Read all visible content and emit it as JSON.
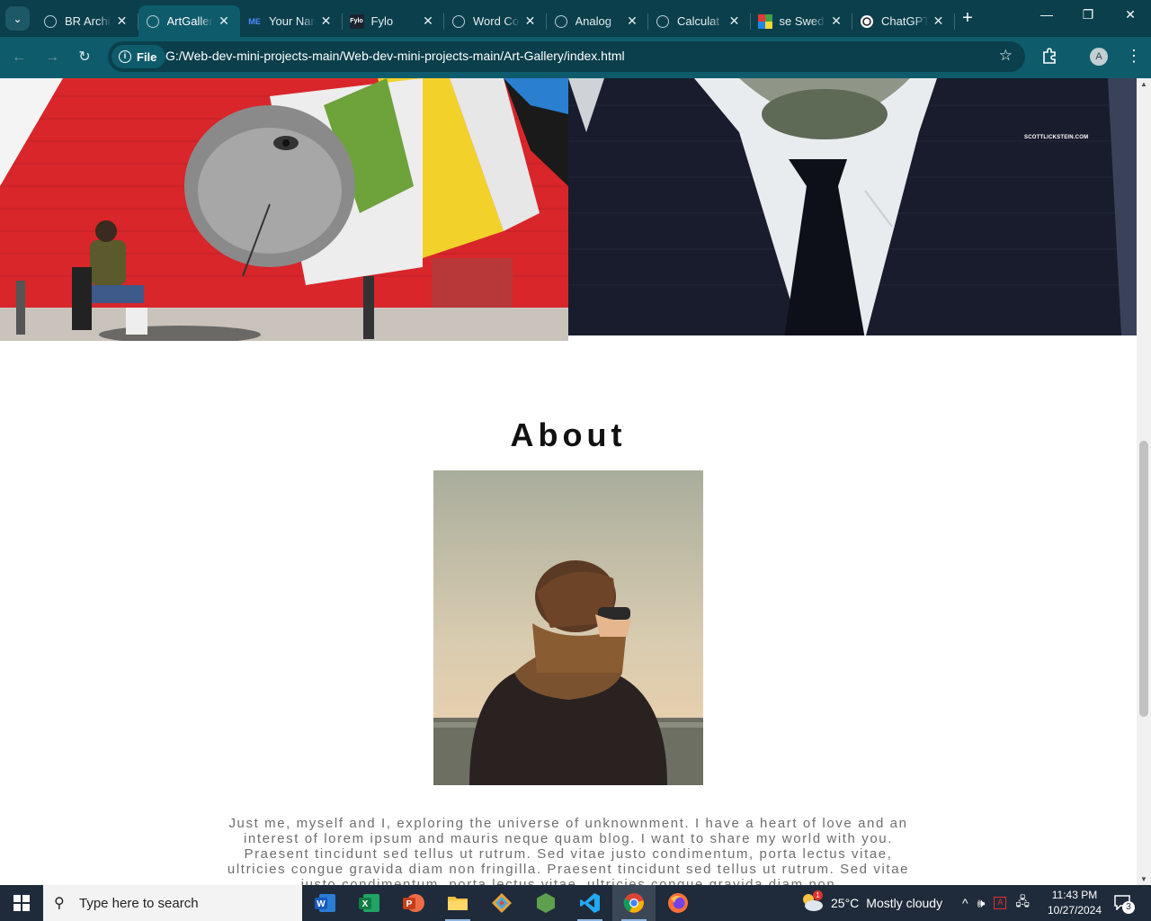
{
  "browser": {
    "tabs": [
      {
        "title": "BR Archi",
        "icon": "globe-icon"
      },
      {
        "title": "ArtGallery",
        "icon": "globe-icon",
        "active": true
      },
      {
        "title": "Your Name",
        "icon": "me-icon",
        "favicon_text": "ME"
      },
      {
        "title": "Fylo",
        "icon": "fylo-icon",
        "favicon_text": "Fylo"
      },
      {
        "title": "Word Co",
        "icon": "globe-icon"
      },
      {
        "title": "Analog",
        "icon": "globe-icon"
      },
      {
        "title": "Calculat",
        "icon": "globe-icon"
      },
      {
        "title": "se Swed",
        "icon": "colorful-grid-icon"
      },
      {
        "title": "ChatGPT",
        "icon": "chatgpt-icon"
      }
    ],
    "address": {
      "chip_label": "File",
      "url": "G:/Web-dev-mini-projects-main/Web-dev-mini-projects-main/Art-Gallery/index.html"
    },
    "profile_initial": "A"
  },
  "page": {
    "watermark": "SCOTTLICKSTEIN.COM",
    "about": {
      "title": "About",
      "text": "Just me, myself and I, exploring the universe of unknownment. I have a heart of love and an interest of lorem ipsum and mauris neque quam blog. I want to share my world with you. Praesent tincidunt sed tellus ut rutrum. Sed vitae justo condimentum, porta lectus vitae, ultricies congue gravida diam non fringilla. Praesent tincidunt sed tellus ut rutrum. Sed vitae justo condimentum, porta lectus vitae, ultricies congue gravida diam non"
    }
  },
  "taskbar": {
    "search_placeholder": "Type here to search",
    "weather": {
      "temp": "25°C",
      "condition": "Mostly cloudy",
      "badge": "1"
    },
    "clock": {
      "time": "11:43 PM",
      "date": "10/27/2024"
    },
    "notifications": "3"
  },
  "colors": {
    "tabstrip": "#0b3f4c",
    "toolbar": "#0e5b6b",
    "taskbar": "#1f2b3a"
  }
}
